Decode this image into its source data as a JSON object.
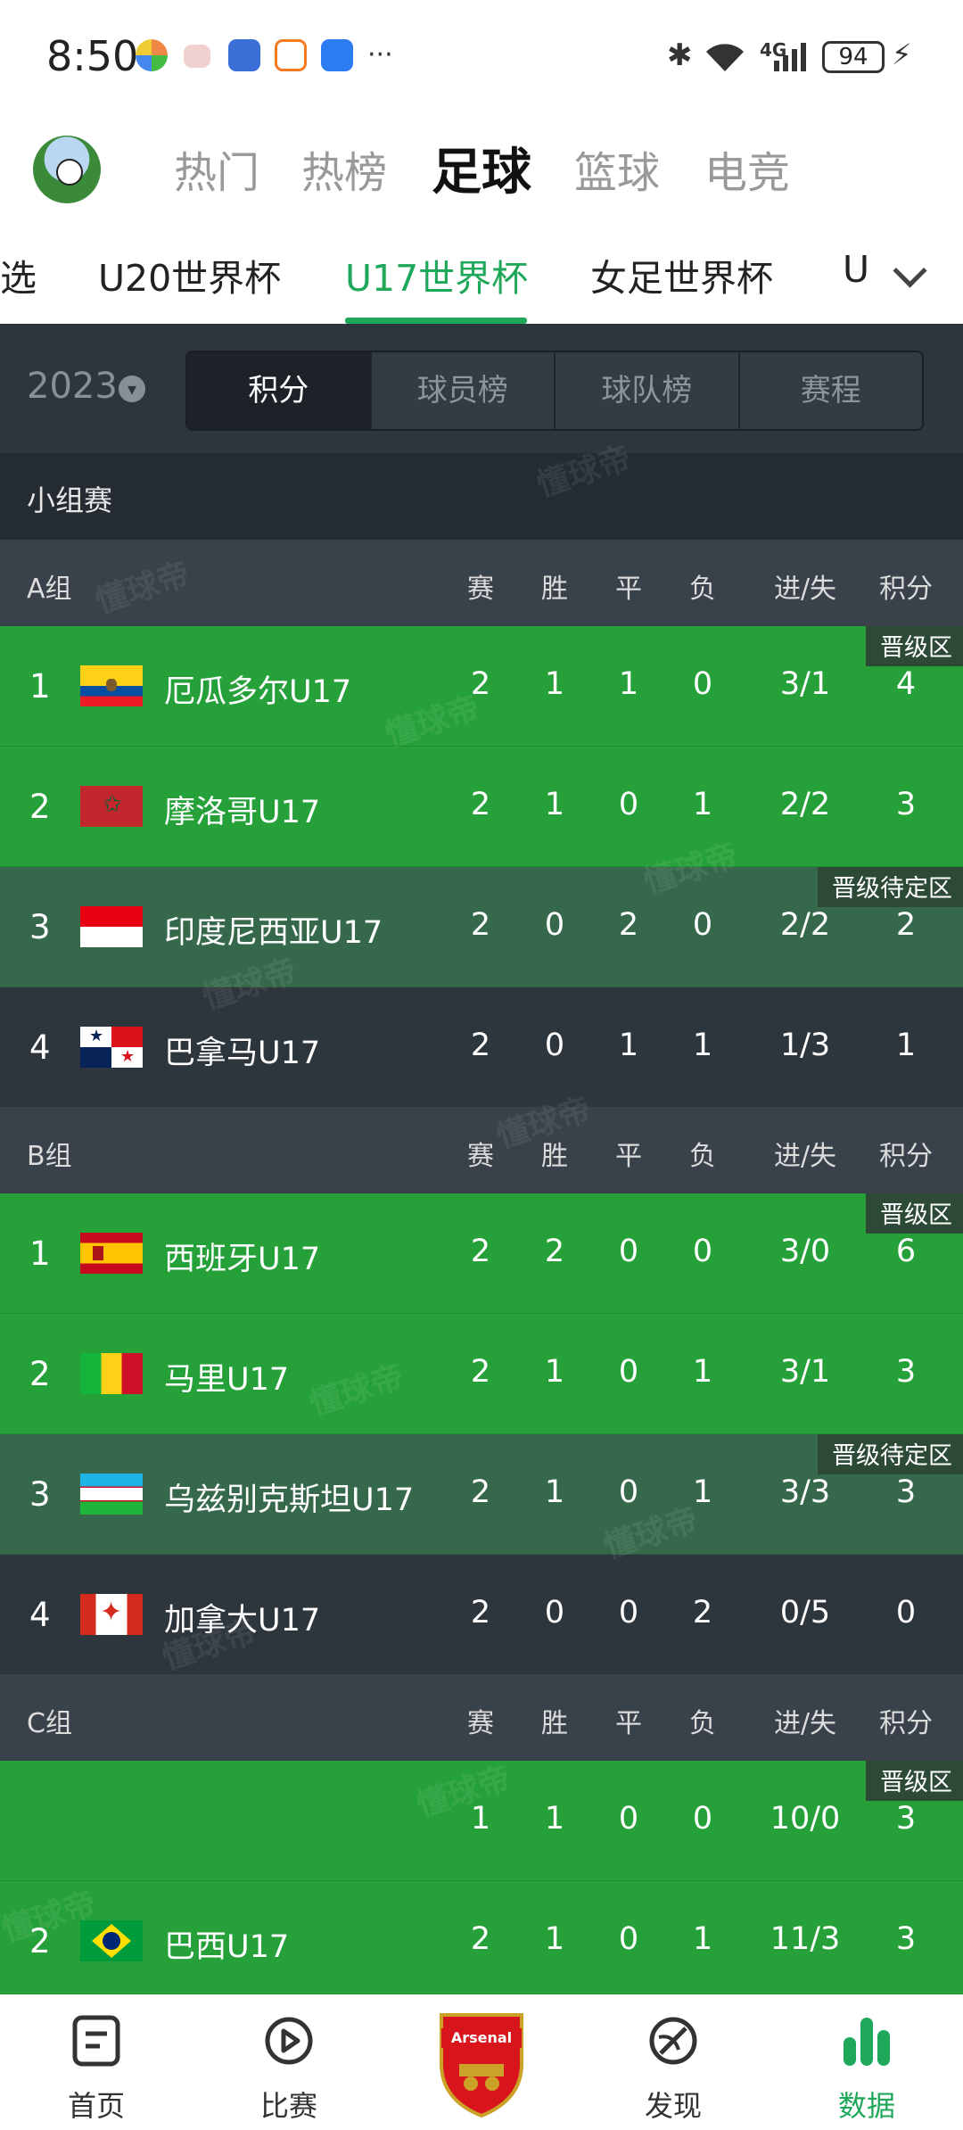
{
  "status_bar": {
    "time": "8:50",
    "more": "···",
    "network": "4G",
    "battery": "94"
  },
  "top_tabs": [
    {
      "label": "热门"
    },
    {
      "label": "热榜"
    },
    {
      "label": "足球"
    },
    {
      "label": "篮球"
    },
    {
      "label": "电竞"
    }
  ],
  "sub_tabs": [
    {
      "label": "选"
    },
    {
      "label": "U20世界杯"
    },
    {
      "label": "U17世界杯"
    },
    {
      "label": "女足世界杯"
    },
    {
      "label": "U"
    }
  ],
  "filter": {
    "year": "2023",
    "segments": [
      {
        "label": "积分"
      },
      {
        "label": "球员榜"
      },
      {
        "label": "球队榜"
      },
      {
        "label": "赛程"
      }
    ]
  },
  "stage_label": "小组赛",
  "columns": {
    "played": "赛",
    "win": "胜",
    "draw": "平",
    "loss": "负",
    "goals": "进/失",
    "points": "积分"
  },
  "badges": {
    "qualify": "晋级区",
    "pending": "晋级待定区"
  },
  "watermark": "懂球帝",
  "groups": [
    {
      "name": "A组",
      "rows": [
        {
          "rank": "1",
          "team": "厄瓜多尔U17",
          "played": "2",
          "win": "1",
          "draw": "1",
          "loss": "0",
          "goals": "3/1",
          "points": "4"
        },
        {
          "rank": "2",
          "team": "摩洛哥U17",
          "played": "2",
          "win": "1",
          "draw": "0",
          "loss": "1",
          "goals": "2/2",
          "points": "3"
        },
        {
          "rank": "3",
          "team": "印度尼西亚U17",
          "played": "2",
          "win": "0",
          "draw": "2",
          "loss": "0",
          "goals": "2/2",
          "points": "2"
        },
        {
          "rank": "4",
          "team": "巴拿马U17",
          "played": "2",
          "win": "0",
          "draw": "1",
          "loss": "1",
          "goals": "1/3",
          "points": "1"
        }
      ]
    },
    {
      "name": "B组",
      "rows": [
        {
          "rank": "1",
          "team": "西班牙U17",
          "played": "2",
          "win": "2",
          "draw": "0",
          "loss": "0",
          "goals": "3/0",
          "points": "6"
        },
        {
          "rank": "2",
          "team": "马里U17",
          "played": "2",
          "win": "1",
          "draw": "0",
          "loss": "1",
          "goals": "3/1",
          "points": "3"
        },
        {
          "rank": "3",
          "team": "乌兹别克斯坦U17",
          "played": "2",
          "win": "1",
          "draw": "0",
          "loss": "1",
          "goals": "3/3",
          "points": "3"
        },
        {
          "rank": "4",
          "team": "加拿大U17",
          "played": "2",
          "win": "0",
          "draw": "0",
          "loss": "2",
          "goals": "0/5",
          "points": "0"
        }
      ]
    },
    {
      "name": "C组",
      "rows": [
        {
          "rank": "",
          "team": "",
          "played": "1",
          "win": "1",
          "draw": "0",
          "loss": "0",
          "goals": "10/0",
          "points": "3"
        },
        {
          "rank": "2",
          "team": "巴西U17",
          "played": "2",
          "win": "1",
          "draw": "0",
          "loss": "1",
          "goals": "11/3",
          "points": "3"
        }
      ]
    }
  ],
  "bottom_nav": [
    {
      "label": "首页"
    },
    {
      "label": "比赛"
    },
    {
      "label": ""
    },
    {
      "label": "发现"
    },
    {
      "label": "数据"
    }
  ],
  "arsenal_text": "Arsenal",
  "colors": {
    "accent": "#1fa85a",
    "qualify_row": "#26a13a",
    "pending_row": "#36694c",
    "default_row": "#2d353d"
  }
}
